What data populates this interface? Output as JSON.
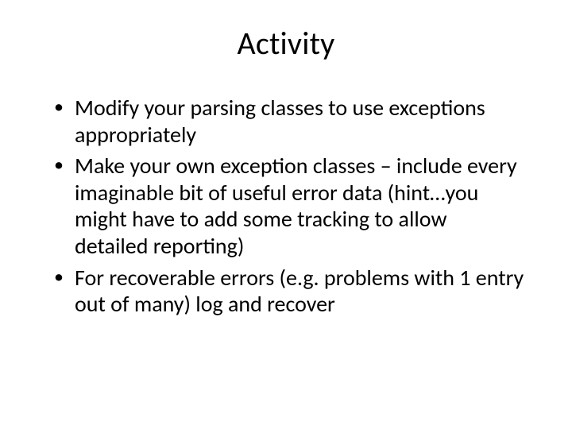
{
  "slide": {
    "title": "Activity",
    "bullets": [
      "Modify your parsing classes to use exceptions appropriately",
      "Make your own exception classes – include every imaginable bit of useful error data (hint…you might have to add some tracking to allow detailed reporting)",
      "For recoverable errors (e.g. problems with 1 entry out of many) log and recover"
    ]
  }
}
